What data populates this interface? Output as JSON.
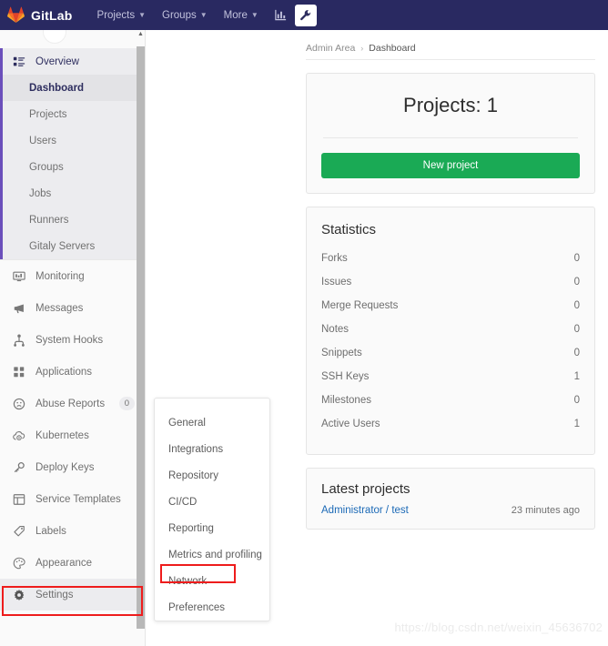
{
  "navbar": {
    "brand": "GitLab",
    "logo_icon": "gitlab-tanuki-icon",
    "items": [
      {
        "label": "Projects",
        "icon": "chevron-down-icon"
      },
      {
        "label": "Groups",
        "icon": "chevron-down-icon"
      },
      {
        "label": "More",
        "icon": "chevron-down-icon"
      }
    ],
    "icons": [
      {
        "name": "chart-icon",
        "active": false
      },
      {
        "name": "wrench-icon",
        "active": true
      }
    ],
    "background": "#292961"
  },
  "sidebar": {
    "overview": {
      "label": "Overview",
      "icon": "overview-list-icon",
      "sub_items": [
        {
          "label": "Dashboard",
          "current": true
        },
        {
          "label": "Projects",
          "current": false
        },
        {
          "label": "Users",
          "current": false
        },
        {
          "label": "Groups",
          "current": false
        },
        {
          "label": "Jobs",
          "current": false
        },
        {
          "label": "Runners",
          "current": false
        },
        {
          "label": "Gitaly Servers",
          "current": false
        }
      ]
    },
    "items": [
      {
        "label": "Monitoring",
        "icon": "monitor-icon",
        "badge": null
      },
      {
        "label": "Messages",
        "icon": "megaphone-icon",
        "badge": null
      },
      {
        "label": "System Hooks",
        "icon": "hook-icon",
        "badge": null
      },
      {
        "label": "Applications",
        "icon": "applications-icon",
        "badge": null
      },
      {
        "label": "Abuse Reports",
        "icon": "abuse-face-icon",
        "badge": "0"
      },
      {
        "label": "Kubernetes",
        "icon": "kubernetes-cloud-icon",
        "badge": null
      },
      {
        "label": "Deploy Keys",
        "icon": "key-icon",
        "badge": null
      },
      {
        "label": "Service Templates",
        "icon": "service-template-icon",
        "badge": null
      },
      {
        "label": "Labels",
        "icon": "label-tag-icon",
        "badge": null
      },
      {
        "label": "Appearance",
        "icon": "palette-icon",
        "badge": null
      },
      {
        "label": "Settings",
        "icon": "gear-icon",
        "badge": null,
        "highlighted": true
      }
    ],
    "scrollbar": {
      "up_arrow_icon": "triangle-up-icon"
    }
  },
  "flyout": {
    "items": [
      {
        "label": "General",
        "highlighted": false
      },
      {
        "label": "Integrations",
        "highlighted": false
      },
      {
        "label": "Repository",
        "highlighted": false
      },
      {
        "label": "CI/CD",
        "highlighted": false
      },
      {
        "label": "Reporting",
        "highlighted": false
      },
      {
        "label": "Metrics and profiling",
        "highlighted": false
      },
      {
        "label": "Network",
        "highlighted": true
      },
      {
        "label": "Preferences",
        "highlighted": false
      }
    ]
  },
  "breadcrumb": {
    "root": "Admin Area",
    "separator": "›",
    "current": "Dashboard"
  },
  "projects_card": {
    "title": "Projects: 1",
    "button_label": "New project",
    "button_color": "#1aaa55"
  },
  "statistics": {
    "title": "Statistics",
    "rows": [
      {
        "label": "Forks",
        "value": "0"
      },
      {
        "label": "Issues",
        "value": "0"
      },
      {
        "label": "Merge Requests",
        "value": "0"
      },
      {
        "label": "Notes",
        "value": "0"
      },
      {
        "label": "Snippets",
        "value": "0"
      },
      {
        "label": "SSH Keys",
        "value": "1"
      },
      {
        "label": "Milestones",
        "value": "0"
      },
      {
        "label": "Active Users",
        "value": "1"
      }
    ]
  },
  "latest_projects": {
    "title": "Latest projects",
    "rows": [
      {
        "name": "Administrator / test",
        "time": "23 minutes ago"
      }
    ]
  },
  "watermark": "https://blog.csdn.net/weixin_45636702",
  "annotation_color": "#ee1c1c"
}
